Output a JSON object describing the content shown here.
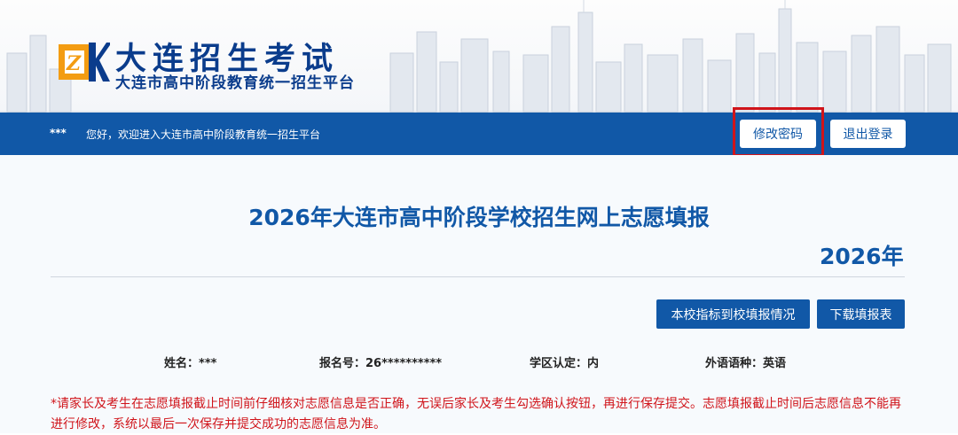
{
  "header": {
    "site_title": "大连招生考试",
    "site_subtitle": "大连市高中阶段教育统一招生平台"
  },
  "navbar": {
    "user_mask": "***",
    "welcome": "您好，欢迎进入大连市高中阶段教育统一招生平台",
    "change_password_label": "修改密码",
    "logout_label": "退出登录"
  },
  "main": {
    "title": "2026年大连市高中阶段学校招生网上志愿填报",
    "year": "2026年",
    "school_quota_button": "本校指标到校填报情况",
    "download_button": "下载填报表",
    "student": {
      "name_label": "姓名：",
      "name_value": "***",
      "reg_label": "报名号：",
      "reg_value": "26**********",
      "district_label": "学区认定：",
      "district_value": "内",
      "language_label": "外语语种：",
      "language_value": "英语"
    },
    "notice": "*请家长及考生在志愿填报截止时间前仔细核对志愿信息是否正确，无误后家长及考生勾选确认按钮，再进行保存提交。志愿填报截止时间后志愿信息不能再进行修改，系统以最后一次保存并提交成功的志愿信息为准。"
  },
  "colors": {
    "primary": "#1158a7",
    "title_navy": "#0a3c8c",
    "logo_orange": "#f39c12",
    "alert_red": "#d0141a"
  }
}
